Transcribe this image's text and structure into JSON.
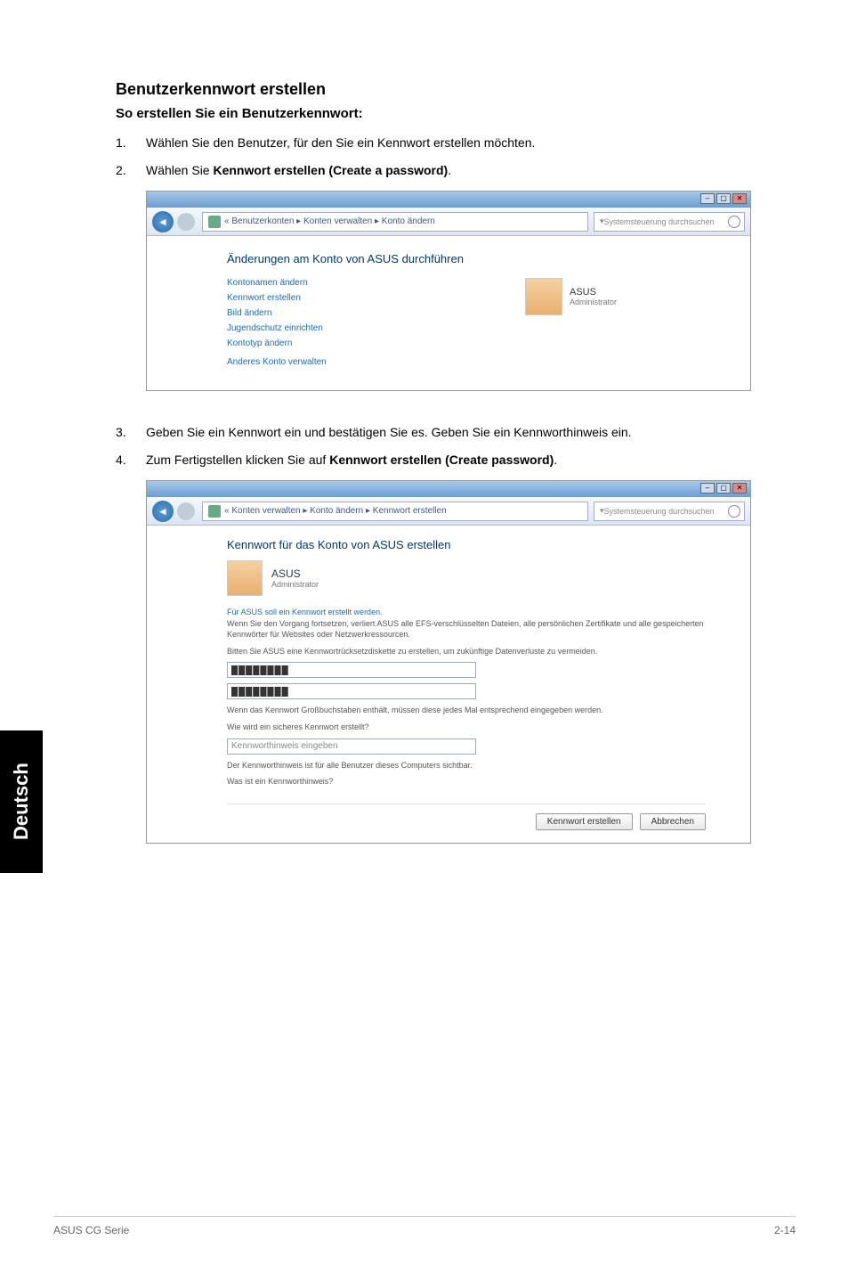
{
  "side_tab": "Deutsch",
  "heading": "Benutzerkennwort erstellen",
  "subheading": "So erstellen Sie ein Benutzerkennwort:",
  "steps": {
    "s1_num": "1.",
    "s1_text": "Wählen Sie den Benutzer, für den Sie ein Kennwort erstellen möchten.",
    "s2_num": "2.",
    "s2_prefix": "Wählen Sie ",
    "s2_bold": "Kennwort erstellen (Create a password)",
    "s2_suffix": ".",
    "s3_num": "3.",
    "s3_text": "Geben Sie ein Kennwort ein und bestätigen Sie es. Geben Sie ein Kennworthinweis ein.",
    "s4_num": "4.",
    "s4_prefix": "Zum Fertigstellen klicken Sie auf ",
    "s4_bold": "Kennwort erstellen (Create password)",
    "s4_suffix": "."
  },
  "screenshot1": {
    "breadcrumb": "« Benutzerkonten ▸ Konten verwalten ▸ Konto ändern",
    "search_dropdown": "▾ ",
    "search_placeholder": "Systemsteuerung durchsuchen",
    "content_heading": "Änderungen am Konto von ASUS durchführen",
    "options": {
      "o1": "Kontonamen ändern",
      "o2": "Kennwort erstellen",
      "o3": "Bild ändern",
      "o4": "Jugendschutz einrichten",
      "o5": "Kontotyp ändern",
      "o6": "Anderes Konto verwalten"
    },
    "user": {
      "name": "ASUS",
      "role": "Administrator"
    }
  },
  "screenshot2": {
    "breadcrumb": "« Konten verwalten ▸ Konto ändern ▸ Kennwort erstellen",
    "search_placeholder": "Systemsteuerung durchsuchen",
    "content_heading": "Kennwort für das Konto von ASUS erstellen",
    "user": {
      "name": "ASUS",
      "role": "Administrator"
    },
    "warning1": "Für ASUS soll ein Kennwort erstellt werden.",
    "warning2": "Wenn Sie den Vorgang fortsetzen, verliert ASUS alle EFS-verschlüsselten Dateien, alle persönlichen Zertifikate und alle gespeicherten Kennwörter für Websites oder Netzwerkressourcen.",
    "warning3": "Bitten Sie ASUS eine Kennwortrücksetzdiskette zu erstellen, um zukünftige Datenverluste zu vermeiden.",
    "pwd_mask": "████████",
    "info1": "Wenn das Kennwort Großbuchstaben enthält, müssen diese jedes Mal entsprechend eingegeben werden.",
    "link1": "Wie wird ein sicheres Kennwort erstellt?",
    "hint_placeholder": "Kennworthinweis eingeben",
    "info2": "Der Kennworthinweis ist für alle Benutzer dieses Computers sichtbar.",
    "link2": "Was ist ein Kennworthinweis?",
    "btn_create": "Kennwort erstellen",
    "btn_cancel": "Abbrechen"
  },
  "footer": {
    "left": "ASUS CG Serie",
    "right": "2-14"
  }
}
